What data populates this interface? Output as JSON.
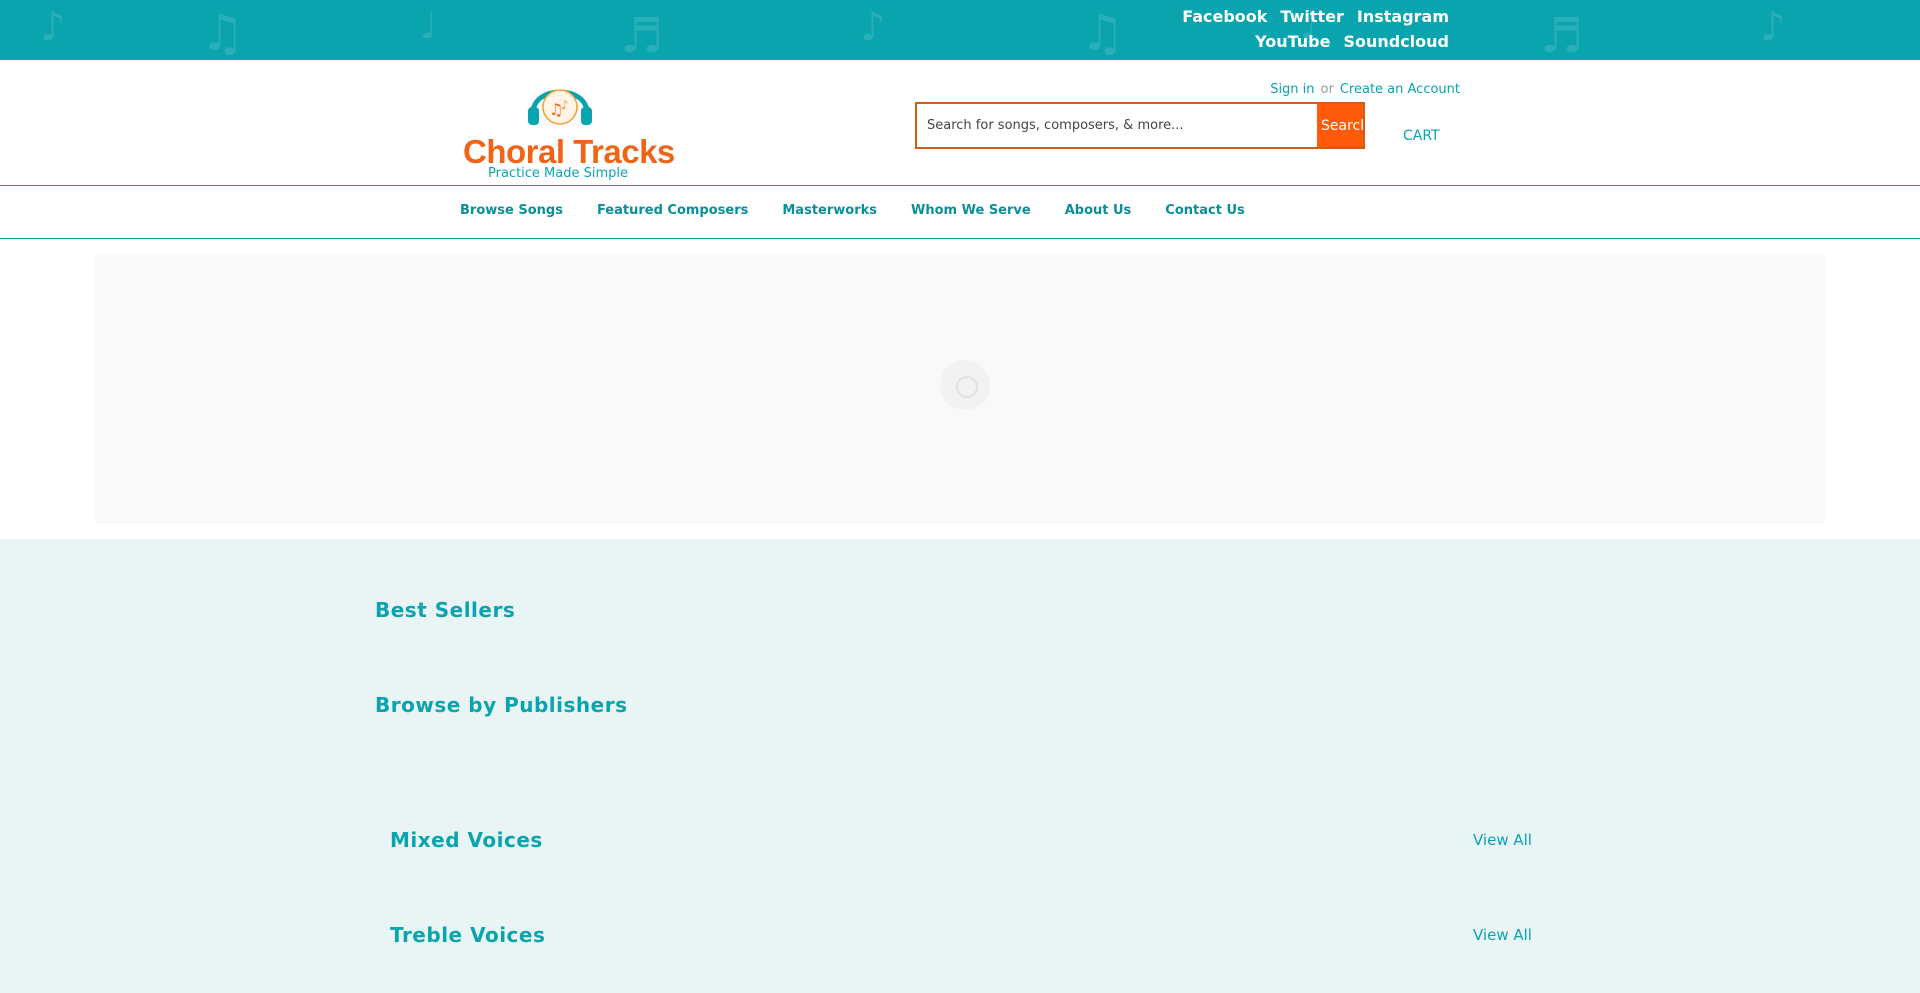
{
  "social": {
    "row1": [
      "Facebook",
      "Twitter",
      "Instagram"
    ],
    "row2": [
      "YouTube",
      "Soundcloud"
    ]
  },
  "header": {
    "logo_title": "Choral Tracks",
    "logo_tagline": "Practice Made Simple",
    "sign_in": "Sign in",
    "or": "or",
    "create_account": "Create an Account",
    "search_placeholder": "Search for songs, composers, & more...",
    "search_button": "Search",
    "cart": "CART"
  },
  "nav": {
    "items": [
      "Browse Songs",
      "Featured Composers",
      "Masterworks",
      "Whom We Serve",
      "About Us",
      "Contact Us"
    ]
  },
  "sections": {
    "best_sellers": "Best Sellers",
    "browse_publishers": "Browse by Publishers",
    "mixed_voices": "Mixed Voices",
    "treble_voices": "Treble Voices",
    "view_all": "View All"
  },
  "colors": {
    "brand_teal": "#0aa4ae",
    "brand_orange": "#f06418",
    "search_button": "#ff5a0a",
    "content_bg": "#e9f4f5"
  }
}
